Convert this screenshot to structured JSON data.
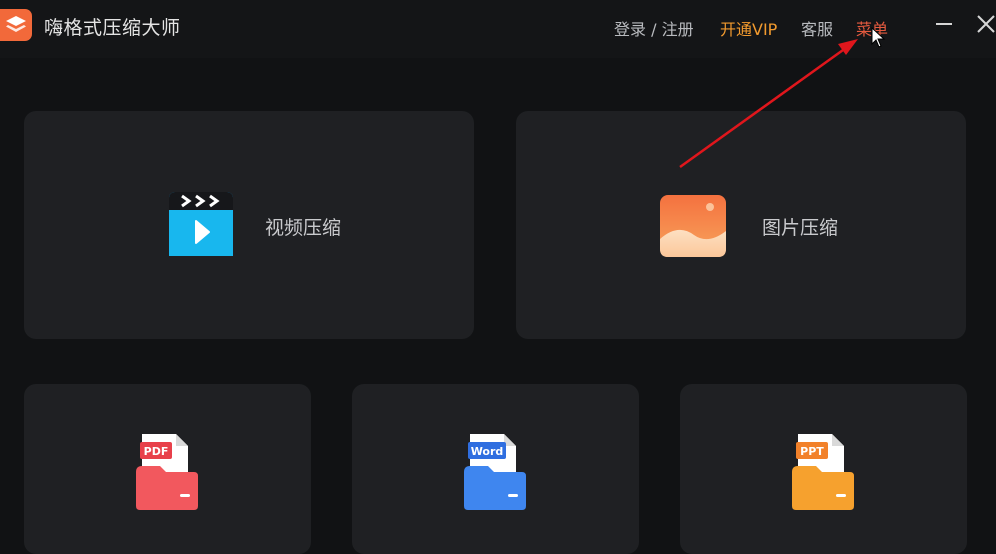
{
  "app": {
    "title": "嗨格式压缩大师",
    "logo_icon": "layers-icon",
    "brand_color": "#f2693a"
  },
  "header": {
    "login_label": "登录 / 注册",
    "vip_label": "开通VIP",
    "service_label": "客服",
    "menu_label": "菜单",
    "vip_color": "#f29a2e",
    "menu_color": "#e55a3f",
    "minimize_icon": "minimize-icon",
    "close_icon": "close-icon"
  },
  "cards": {
    "video": {
      "label": "视频压缩",
      "icon": "video-clapper-icon"
    },
    "image": {
      "label": "图片压缩",
      "icon": "image-landscape-icon"
    },
    "pdf": {
      "tag": "PDF",
      "icon": "pdf-folder-icon"
    },
    "word": {
      "tag": "Word",
      "icon": "word-folder-icon"
    },
    "ppt": {
      "tag": "PPT",
      "icon": "ppt-folder-icon"
    }
  },
  "annotation": {
    "arrow_color": "#e0161c"
  }
}
